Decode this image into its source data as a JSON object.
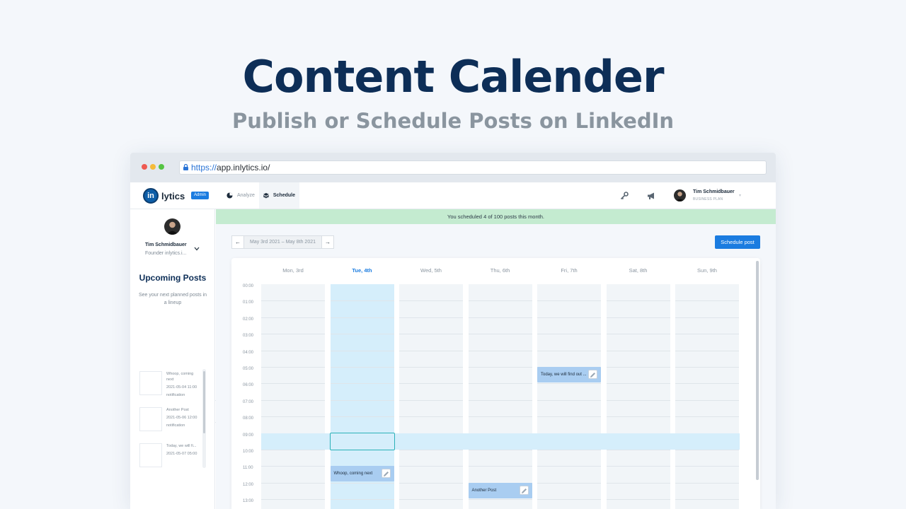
{
  "hero": {
    "title": "Content Calender",
    "subtitle": "Publish or Schedule Posts on LinkedIn"
  },
  "browser": {
    "url_scheme": "https://",
    "url_host": "app.inlytics.io/"
  },
  "topnav": {
    "logo_mark": "in",
    "logo_text": "lytics",
    "admin_badge": "Admin",
    "tabs": [
      {
        "label": "Analyze",
        "icon": "pie-chart-icon",
        "active": false
      },
      {
        "label": "Schedule",
        "icon": "layers-icon",
        "active": true
      }
    ],
    "icons": [
      "key-icon",
      "megaphone-icon"
    ],
    "user_name": "Tim Schmidbauer",
    "user_plan": "BUSINESS PLAN"
  },
  "sidebar": {
    "name": "Tim Schmidbauer",
    "role": "Founder inlytics.i...",
    "upcoming_title": "Upcoming Posts",
    "upcoming_desc": "See your next planned posts in a lineup",
    "posts": [
      {
        "text": "Whoop, coming next",
        "datetime": "2021-05-04 11:00",
        "type": "notification"
      },
      {
        "text": "Another Post",
        "datetime": "2021-05-06 12:00",
        "type": "notification"
      },
      {
        "text": "Today, we will fi...",
        "datetime": "2021-05-07 05:00",
        "type": ""
      }
    ]
  },
  "main": {
    "banner": "You scheduled 4 of 100 posts this month.",
    "week_range": "May 3rd 2021 – May 8th 2021",
    "prev_label": "←",
    "next_label": "→",
    "schedule_button": "Schedule post"
  },
  "calendar": {
    "days": [
      {
        "label": "Mon, 3rd",
        "active": false
      },
      {
        "label": "Tue, 4th",
        "active": true
      },
      {
        "label": "Wed, 5th",
        "active": false
      },
      {
        "label": "Thu, 6th",
        "active": false
      },
      {
        "label": "Fri, 7th",
        "active": false
      },
      {
        "label": "Sat, 8th",
        "active": false
      },
      {
        "label": "Sun, 9th",
        "active": false
      }
    ],
    "hours": [
      "00:00",
      "01:00",
      "02:00",
      "03:00",
      "04:00",
      "05:00",
      "06:00",
      "07:00",
      "08:00",
      "09:00",
      "10:00",
      "11:00",
      "12:00",
      "13:00"
    ],
    "highlight_hour": "09:00",
    "selected_cell": {
      "day": "Tue, 4th",
      "hour": "09:00"
    },
    "events": [
      {
        "day": "Fri, 7th",
        "hour": "05:00",
        "title": "Today, we will find out ..."
      },
      {
        "day": "Tue, 4th",
        "hour": "11:00",
        "title": "Whoop, coming next"
      },
      {
        "day": "Thu, 6th",
        "hour": "12:00",
        "title": "Another Post"
      }
    ]
  },
  "colors": {
    "hero_title": "#0d2e57",
    "hero_subtitle": "#8a959f",
    "accent": "#1b7ce0",
    "banner": "#c4ebd0",
    "event": "#a9cdf1",
    "active_column": "#d5eefb"
  }
}
